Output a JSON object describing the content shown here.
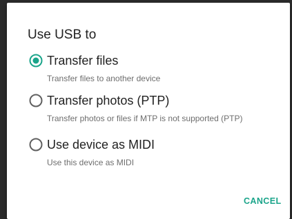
{
  "dialog": {
    "title": "Use USB to",
    "options": [
      {
        "label": "Transfer files",
        "description": "Transfer files to another device",
        "selected": true
      },
      {
        "label": "Transfer photos (PTP)",
        "description": "Transfer photos or files if MTP is not supported (PTP)",
        "selected": false
      },
      {
        "label": "Use device as MIDI",
        "description": "Use this device as MIDI",
        "selected": false
      }
    ],
    "cancel_label": "CANCEL"
  },
  "colors": {
    "accent": "#1aa48a",
    "radio_unselected": "#5f5f5f",
    "text_primary": "#212121",
    "text_secondary": "#6d6d6d"
  },
  "icons": {
    "selected_radio": "radio-selected-icon",
    "unselected_radio": "radio-unselected-icon"
  }
}
